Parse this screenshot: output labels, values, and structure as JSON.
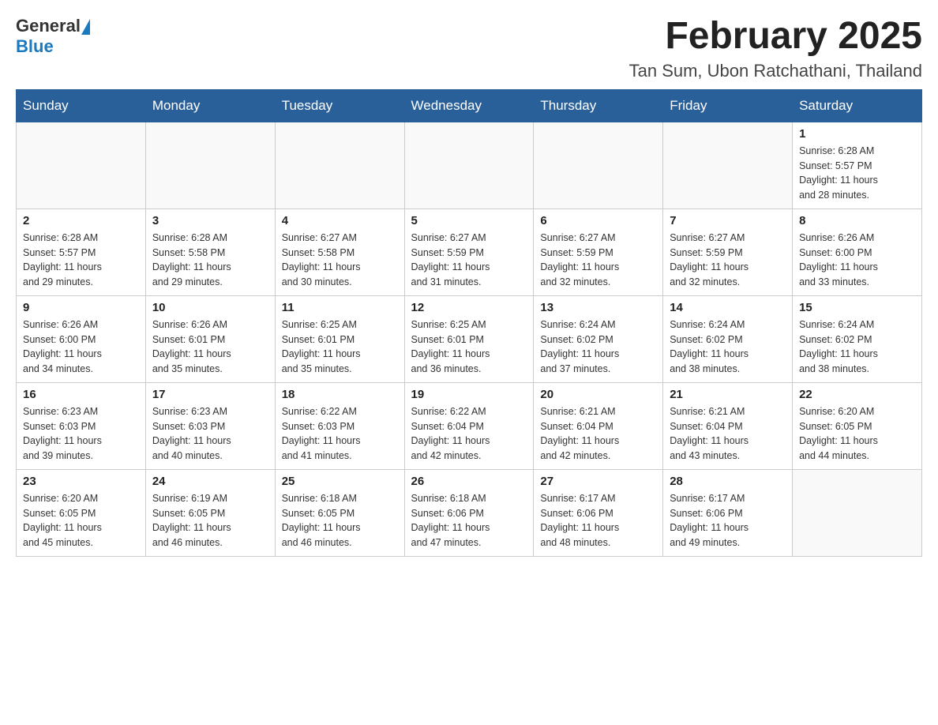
{
  "logo": {
    "text_general": "General",
    "text_triangle": "▲",
    "text_blue": "Blue"
  },
  "header": {
    "month_title": "February 2025",
    "location": "Tan Sum, Ubon Ratchathani, Thailand"
  },
  "weekdays": [
    "Sunday",
    "Monday",
    "Tuesday",
    "Wednesday",
    "Thursday",
    "Friday",
    "Saturday"
  ],
  "weeks": [
    {
      "days": [
        {
          "num": "",
          "info": ""
        },
        {
          "num": "",
          "info": ""
        },
        {
          "num": "",
          "info": ""
        },
        {
          "num": "",
          "info": ""
        },
        {
          "num": "",
          "info": ""
        },
        {
          "num": "",
          "info": ""
        },
        {
          "num": "1",
          "info": "Sunrise: 6:28 AM\nSunset: 5:57 PM\nDaylight: 11 hours\nand 28 minutes."
        }
      ]
    },
    {
      "days": [
        {
          "num": "2",
          "info": "Sunrise: 6:28 AM\nSunset: 5:57 PM\nDaylight: 11 hours\nand 29 minutes."
        },
        {
          "num": "3",
          "info": "Sunrise: 6:28 AM\nSunset: 5:58 PM\nDaylight: 11 hours\nand 29 minutes."
        },
        {
          "num": "4",
          "info": "Sunrise: 6:27 AM\nSunset: 5:58 PM\nDaylight: 11 hours\nand 30 minutes."
        },
        {
          "num": "5",
          "info": "Sunrise: 6:27 AM\nSunset: 5:59 PM\nDaylight: 11 hours\nand 31 minutes."
        },
        {
          "num": "6",
          "info": "Sunrise: 6:27 AM\nSunset: 5:59 PM\nDaylight: 11 hours\nand 32 minutes."
        },
        {
          "num": "7",
          "info": "Sunrise: 6:27 AM\nSunset: 5:59 PM\nDaylight: 11 hours\nand 32 minutes."
        },
        {
          "num": "8",
          "info": "Sunrise: 6:26 AM\nSunset: 6:00 PM\nDaylight: 11 hours\nand 33 minutes."
        }
      ]
    },
    {
      "days": [
        {
          "num": "9",
          "info": "Sunrise: 6:26 AM\nSunset: 6:00 PM\nDaylight: 11 hours\nand 34 minutes."
        },
        {
          "num": "10",
          "info": "Sunrise: 6:26 AM\nSunset: 6:01 PM\nDaylight: 11 hours\nand 35 minutes."
        },
        {
          "num": "11",
          "info": "Sunrise: 6:25 AM\nSunset: 6:01 PM\nDaylight: 11 hours\nand 35 minutes."
        },
        {
          "num": "12",
          "info": "Sunrise: 6:25 AM\nSunset: 6:01 PM\nDaylight: 11 hours\nand 36 minutes."
        },
        {
          "num": "13",
          "info": "Sunrise: 6:24 AM\nSunset: 6:02 PM\nDaylight: 11 hours\nand 37 minutes."
        },
        {
          "num": "14",
          "info": "Sunrise: 6:24 AM\nSunset: 6:02 PM\nDaylight: 11 hours\nand 38 minutes."
        },
        {
          "num": "15",
          "info": "Sunrise: 6:24 AM\nSunset: 6:02 PM\nDaylight: 11 hours\nand 38 minutes."
        }
      ]
    },
    {
      "days": [
        {
          "num": "16",
          "info": "Sunrise: 6:23 AM\nSunset: 6:03 PM\nDaylight: 11 hours\nand 39 minutes."
        },
        {
          "num": "17",
          "info": "Sunrise: 6:23 AM\nSunset: 6:03 PM\nDaylight: 11 hours\nand 40 minutes."
        },
        {
          "num": "18",
          "info": "Sunrise: 6:22 AM\nSunset: 6:03 PM\nDaylight: 11 hours\nand 41 minutes."
        },
        {
          "num": "19",
          "info": "Sunrise: 6:22 AM\nSunset: 6:04 PM\nDaylight: 11 hours\nand 42 minutes."
        },
        {
          "num": "20",
          "info": "Sunrise: 6:21 AM\nSunset: 6:04 PM\nDaylight: 11 hours\nand 42 minutes."
        },
        {
          "num": "21",
          "info": "Sunrise: 6:21 AM\nSunset: 6:04 PM\nDaylight: 11 hours\nand 43 minutes."
        },
        {
          "num": "22",
          "info": "Sunrise: 6:20 AM\nSunset: 6:05 PM\nDaylight: 11 hours\nand 44 minutes."
        }
      ]
    },
    {
      "days": [
        {
          "num": "23",
          "info": "Sunrise: 6:20 AM\nSunset: 6:05 PM\nDaylight: 11 hours\nand 45 minutes."
        },
        {
          "num": "24",
          "info": "Sunrise: 6:19 AM\nSunset: 6:05 PM\nDaylight: 11 hours\nand 46 minutes."
        },
        {
          "num": "25",
          "info": "Sunrise: 6:18 AM\nSunset: 6:05 PM\nDaylight: 11 hours\nand 46 minutes."
        },
        {
          "num": "26",
          "info": "Sunrise: 6:18 AM\nSunset: 6:06 PM\nDaylight: 11 hours\nand 47 minutes."
        },
        {
          "num": "27",
          "info": "Sunrise: 6:17 AM\nSunset: 6:06 PM\nDaylight: 11 hours\nand 48 minutes."
        },
        {
          "num": "28",
          "info": "Sunrise: 6:17 AM\nSunset: 6:06 PM\nDaylight: 11 hours\nand 49 minutes."
        },
        {
          "num": "",
          "info": ""
        }
      ]
    }
  ]
}
